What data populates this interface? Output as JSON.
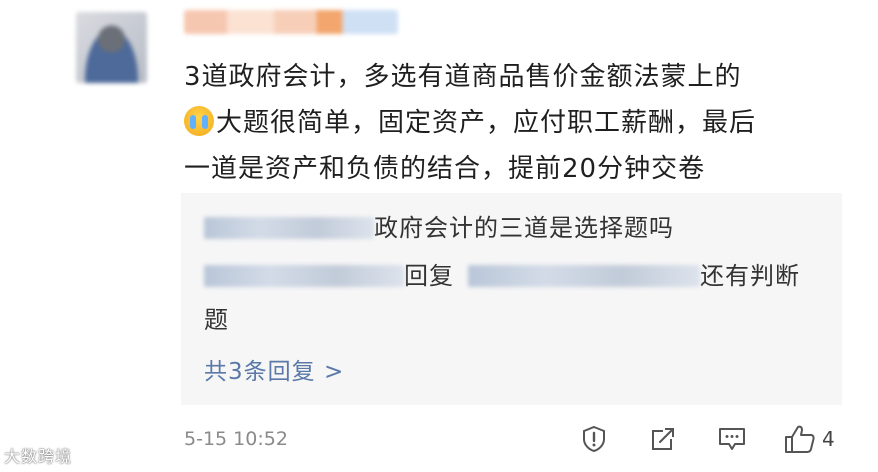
{
  "comment": {
    "lines": [
      "3道政府会计，多选有道商品售价金额法蒙上的",
      "大题很简单，固定资产，应付职工薪酬，最后",
      "一道是资产和负债的结合，提前20分钟交卷"
    ],
    "emoji_icon": "crying-face-emoji"
  },
  "replies": [
    {
      "text": "政府会计的三道是选择题吗"
    },
    {
      "verb": "回复",
      "text_line1": "还有判断",
      "text_line2": "题"
    }
  ],
  "more_replies_label": "共3条回复 >",
  "meta": {
    "timestamp": "5-15 10:52",
    "like_count": "4"
  },
  "actions": [
    "report-icon",
    "share-icon",
    "comment-icon",
    "like-icon"
  ],
  "watermark": "大数跨境",
  "colors": {
    "link": "#5a79a8",
    "reply_bg": "#f6f6f6",
    "meta_text": "#8a8a8a"
  }
}
